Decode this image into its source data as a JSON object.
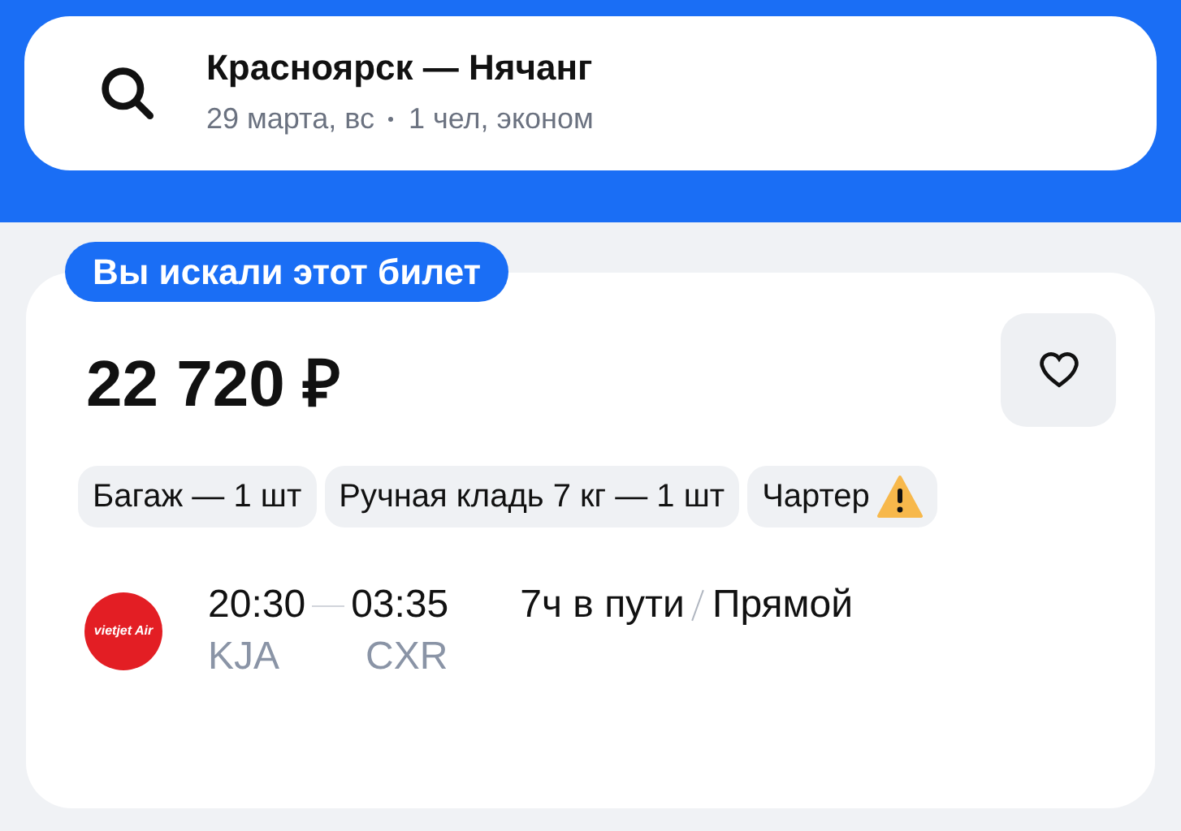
{
  "search": {
    "route": "Красноярск — Нячанг",
    "details": [
      "29 марта, вс",
      "1 чел, эконом"
    ]
  },
  "badge": "Вы искали этот билет",
  "ticket": {
    "price": "22 720 ₽",
    "favorite": false,
    "tags": [
      {
        "label": "Багаж — 1 шт",
        "warning": false
      },
      {
        "label": "Ручная кладь 7 кг — 1 шт",
        "warning": false
      },
      {
        "label": "Чартер",
        "warning": true
      }
    ],
    "flight": {
      "airline_logo": "vietjet Air",
      "departure_time": "20:30",
      "arrival_time": "03:35",
      "departure_airport": "KJA",
      "arrival_airport": "CXR",
      "duration": "7ч в пути",
      "stops": "Прямой"
    }
  }
}
